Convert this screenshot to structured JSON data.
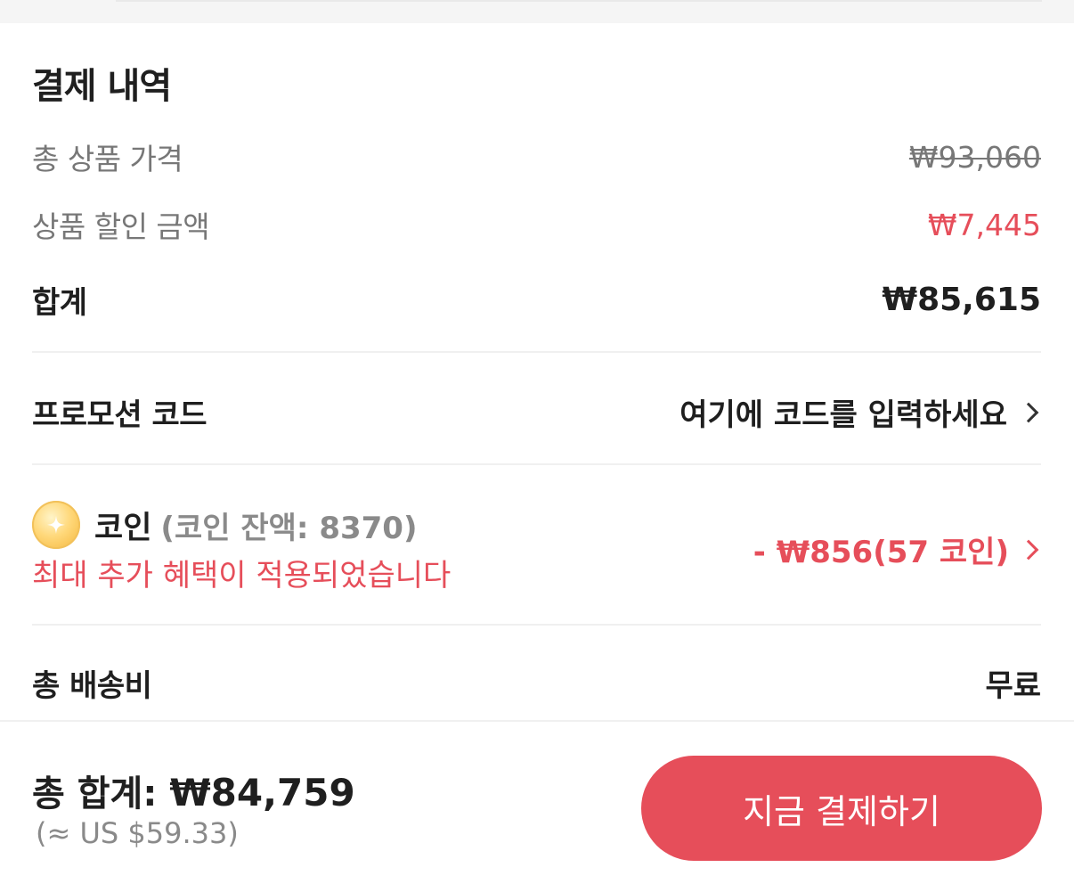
{
  "payment": {
    "title": "결제 내역",
    "total_product_price_label": "총 상품 가격",
    "total_product_price": "₩93,060",
    "product_discount_label": "상품 할인 금액",
    "product_discount": "₩7,445",
    "subtotal_label": "합계",
    "subtotal": "₩85,615"
  },
  "promo": {
    "label": "프로모션 코드",
    "placeholder": "여기에 코드를 입력하세요"
  },
  "coin": {
    "icon": "coin-icon",
    "label": "코인",
    "balance": "(코인 잔액: 8370)",
    "note": "최대 추가 혜택이 적용되었습니다",
    "discount": "- ₩856(57 코인)"
  },
  "shipping": {
    "label": "총 배송비",
    "value": "무료"
  },
  "footer": {
    "grand_total_label": "총 합계:",
    "grand_total": "₩84,759",
    "usd_equivalent": "(≈ US $59.33)",
    "pay_button": "지금 결제하기"
  },
  "colors": {
    "accent": "#e64e5a",
    "text": "#1f1f1f",
    "muted": "#777777"
  }
}
